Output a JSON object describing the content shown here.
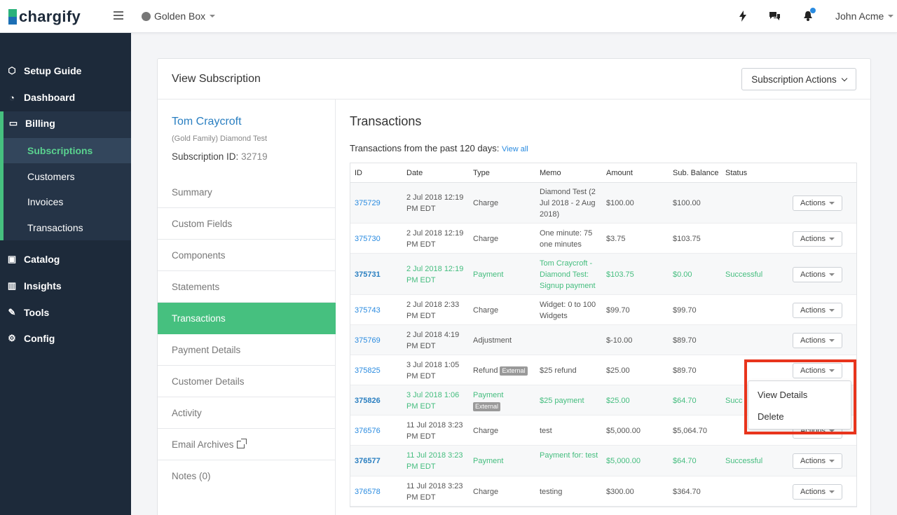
{
  "topbar": {
    "brand": "chargify",
    "site_name": "Golden Box",
    "user_name": "John Acme"
  },
  "sidebar": {
    "items": [
      {
        "label": "Setup Guide",
        "icon": "cube-icon"
      },
      {
        "label": "Dashboard",
        "icon": "dashboard-icon"
      },
      {
        "label": "Billing",
        "icon": "credit-card-icon"
      },
      {
        "label": "Catalog",
        "icon": "briefcase-icon"
      },
      {
        "label": "Insights",
        "icon": "bar-chart-icon"
      },
      {
        "label": "Tools",
        "icon": "wrench-icon"
      },
      {
        "label": "Config",
        "icon": "gear-icon"
      }
    ],
    "billing_sub": [
      "Subscriptions",
      "Customers",
      "Invoices",
      "Transactions"
    ]
  },
  "card": {
    "title": "View Subscription",
    "actions_label": "Subscription Actions"
  },
  "customer": {
    "name": "Tom Craycroft",
    "plan": "(Gold Family) Diamond Test",
    "sub_id_label": "Subscription ID:",
    "sub_id": "32719"
  },
  "menu": [
    "Summary",
    "Custom Fields",
    "Components",
    "Statements",
    "Transactions",
    "Payment Details",
    "Customer Details",
    "Activity",
    "Email Archives",
    "Notes (0)"
  ],
  "transactions": {
    "title": "Transactions",
    "subtitle": "Transactions from the past 120 days:",
    "view_all": "View all",
    "columns": [
      "ID",
      "Date",
      "Type",
      "Memo",
      "Amount",
      "Sub. Balance",
      "Status"
    ],
    "rows": [
      {
        "id": "375729",
        "date": "2 Jul 2018 12:19 PM EDT",
        "type": "Charge",
        "memo": "Diamond Test (2 Jul 2018 - 2 Aug 2018)",
        "amount": "$100.00",
        "balance": "$100.00",
        "status": "",
        "badge": ""
      },
      {
        "id": "375730",
        "date": "2 Jul 2018 12:19 PM EDT",
        "type": "Charge",
        "memo": "One minute: 75 one minutes",
        "amount": "$3.75",
        "balance": "$103.75",
        "status": "",
        "badge": ""
      },
      {
        "id": "375731",
        "date": "2 Jul 2018 12:19 PM EDT",
        "type": "Payment",
        "memo": "Tom Craycroft - Diamond Test: Signup payment",
        "amount": "$103.75",
        "balance": "$0.00",
        "status": "Successful",
        "badge": ""
      },
      {
        "id": "375743",
        "date": "2 Jul 2018 2:33 PM EDT",
        "type": "Charge",
        "memo": "Widget: 0 to 100 Widgets",
        "amount": "$99.70",
        "balance": "$99.70",
        "status": "",
        "badge": ""
      },
      {
        "id": "375769",
        "date": "2 Jul 2018 4:19 PM EDT",
        "type": "Adjustment",
        "memo": "",
        "amount": "$-10.00",
        "balance": "$89.70",
        "status": "",
        "badge": ""
      },
      {
        "id": "375825",
        "date": "3 Jul 2018 1:05 PM EDT",
        "type": "Refund",
        "memo": "$25 refund",
        "amount": "$25.00",
        "balance": "$89.70",
        "status": "",
        "badge": "External"
      },
      {
        "id": "375826",
        "date": "3 Jul 2018 1:06 PM EDT",
        "type": "Payment",
        "memo": "$25 payment",
        "amount": "$25.00",
        "balance": "$64.70",
        "status": "Succ",
        "badge": "External"
      },
      {
        "id": "376576",
        "date": "11 Jul 2018 3:23 PM EDT",
        "type": "Charge",
        "memo": "test",
        "amount": "$5,000.00",
        "balance": "$5,064.70",
        "status": "",
        "badge": ""
      },
      {
        "id": "376577",
        "date": "11 Jul 2018 3:23 PM EDT",
        "type": "Payment",
        "memo": "Payment for: test",
        "amount": "$5,000.00",
        "balance": "$64.70",
        "status": "Successful",
        "badge": ""
      },
      {
        "id": "376578",
        "date": "11 Jul 2018 3:23 PM EDT",
        "type": "Charge",
        "memo": "testing",
        "amount": "$300.00",
        "balance": "$364.70",
        "status": "",
        "badge": ""
      }
    ],
    "actions_label": "Actions"
  },
  "dropdown": {
    "items": [
      "View Details",
      "Delete"
    ]
  },
  "colors": {
    "sidebar_bg": "#1d2a3a",
    "accent_green": "#46c07f",
    "link_blue": "#2a8be0",
    "highlight_red": "#e8341c"
  }
}
